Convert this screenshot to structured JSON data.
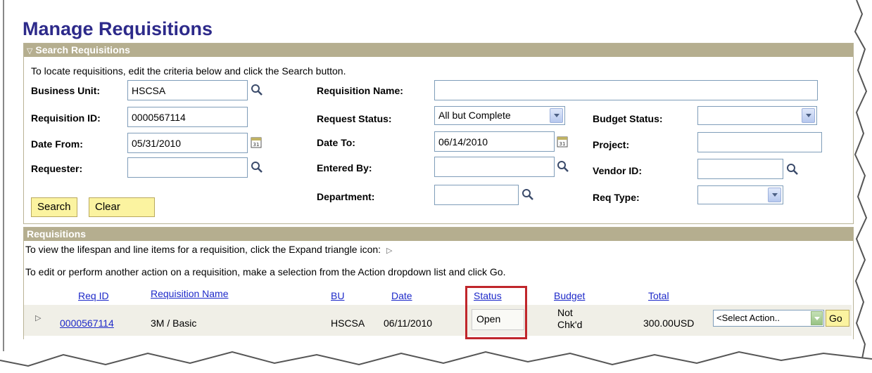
{
  "page_title": "Manage Requisitions",
  "search_panel": {
    "header": "Search Requisitions",
    "instructions": "To locate requisitions, edit the criteria below and click the Search button.",
    "fields": {
      "business_unit": {
        "label": "Business Unit:",
        "value": "HSCSA"
      },
      "requisition_id": {
        "label": "Requisition ID:",
        "value": "0000567114"
      },
      "date_from": {
        "label": "Date From:",
        "value": "05/31/2010"
      },
      "requester": {
        "label": "Requester:",
        "value": ""
      },
      "requisition_name": {
        "label": "Requisition Name:",
        "value": ""
      },
      "request_status": {
        "label": "Request Status:",
        "value": "All but Complete"
      },
      "date_to": {
        "label": "Date To:",
        "value": "06/14/2010"
      },
      "entered_by": {
        "label": "Entered By:",
        "value": ""
      },
      "department": {
        "label": "Department:",
        "value": ""
      },
      "budget_status": {
        "label": "Budget Status:",
        "value": ""
      },
      "project": {
        "label": "Project:",
        "value": ""
      },
      "vendor_id": {
        "label": "Vendor ID:",
        "value": ""
      },
      "req_type": {
        "label": "Req Type:",
        "value": ""
      }
    },
    "search_button": "Search",
    "clear_button": "Clear",
    "calendar_day": "31"
  },
  "requisitions_panel": {
    "header": "Requisitions",
    "instructions_expand": "To view the lifespan and line items for a requisition, click the Expand triangle icon:",
    "instructions_action": "To edit or perform another action on a requisition, make a selection from the Action dropdown list and click Go.",
    "columns": {
      "req_id": "Req ID",
      "requisition_name": "Requisition Name",
      "bu": "BU",
      "date": "Date",
      "status": "Status",
      "budget": "Budget",
      "total": "Total"
    },
    "rows": [
      {
        "req_id": "0000567114",
        "requisition_name": "3M / Basic",
        "bu": "HSCSA",
        "date": "06/11/2010",
        "status": "Open",
        "budget_line1": "Not",
        "budget_line2": "Chk'd",
        "total": "300.00USD",
        "action": "<Select Action..",
        "go": "Go"
      }
    ]
  },
  "colors": {
    "title": "#2d2a8a",
    "panel_header": "#b5ae8f",
    "link": "#1d29c9",
    "button": "#fbf3a0",
    "highlight": "#c0262b"
  }
}
